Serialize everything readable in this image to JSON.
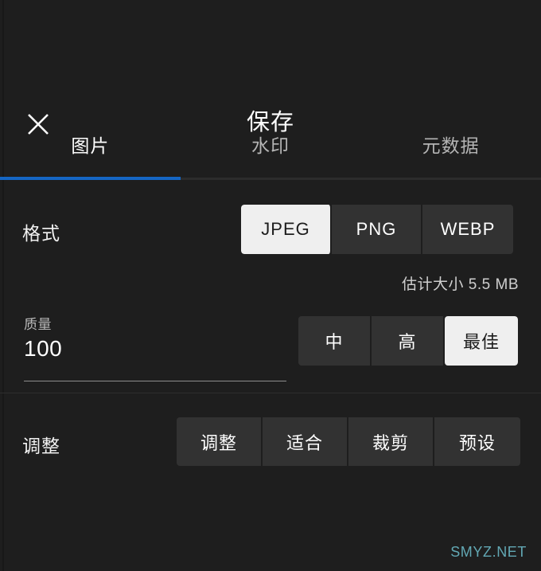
{
  "dialog": {
    "title": "保存",
    "close_icon": "close-icon"
  },
  "tabs": [
    {
      "label": "图片",
      "active": true
    },
    {
      "label": "水印",
      "active": false
    },
    {
      "label": "元数据",
      "active": false
    }
  ],
  "format_section": {
    "label": "格式",
    "options": [
      {
        "label": "JPEG",
        "selected": true
      },
      {
        "label": "PNG",
        "selected": false
      },
      {
        "label": "WEBP",
        "selected": false
      }
    ],
    "estimated_size": "估计大小 5.5 MB"
  },
  "quality_section": {
    "label": "质量",
    "value": "100",
    "options": [
      {
        "label": "中",
        "selected": false
      },
      {
        "label": "高",
        "selected": false
      },
      {
        "label": "最佳",
        "selected": true
      }
    ]
  },
  "adjust_section": {
    "label": "调整",
    "options": [
      {
        "label": "调整",
        "selected": false
      },
      {
        "label": "适合",
        "selected": false
      },
      {
        "label": "裁剪",
        "selected": false
      },
      {
        "label": "预设",
        "selected": false
      }
    ]
  },
  "watermark": {
    "text": "SMYZ.NET",
    "color": "#62a8b4"
  },
  "colors": {
    "background": "#1e1e1e",
    "accent": "#1566c4",
    "button": "#323232",
    "button_selected": "#efefef"
  }
}
